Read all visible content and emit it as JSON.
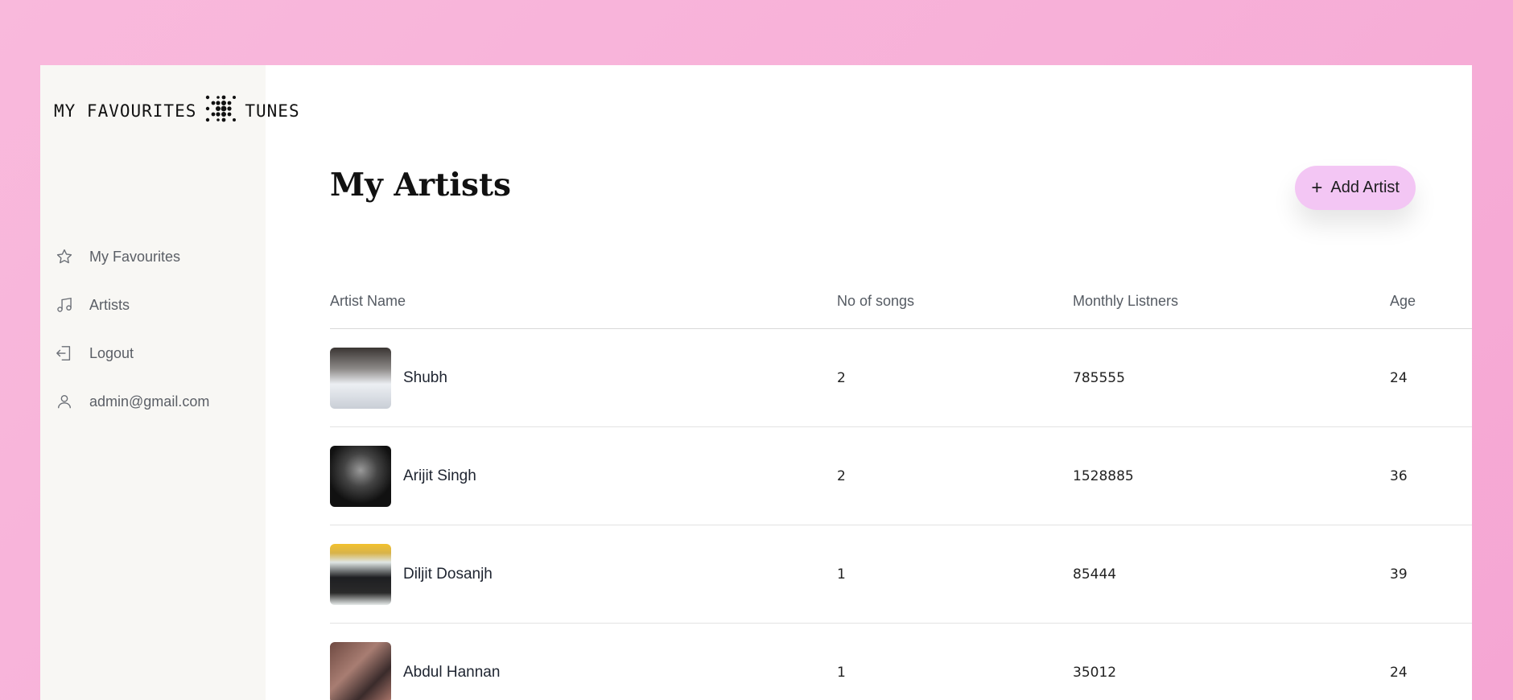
{
  "logo": {
    "left_text": "MY FAVOURITES",
    "right_text": "TUNES",
    "icon": "dotted-waveform-icon"
  },
  "nav": [
    {
      "label": "My Favourites",
      "icon": "star-icon"
    },
    {
      "label": "Artists",
      "icon": "music-note-icon"
    },
    {
      "label": "Logout",
      "icon": "logout-icon"
    },
    {
      "label": "admin@gmail.com",
      "icon": "user-icon"
    }
  ],
  "page": {
    "title": "My Artists"
  },
  "add_button": {
    "icon": "+",
    "label": "Add Artist"
  },
  "table": {
    "headers": [
      "Artist Name",
      "No of songs",
      "Monthly Listners",
      "Age"
    ],
    "rows": [
      {
        "name": "Shubh",
        "songs": "2",
        "listeners": "785555",
        "age": "24"
      },
      {
        "name": "Arijit Singh",
        "songs": "2",
        "listeners": "1528885",
        "age": "36"
      },
      {
        "name": "Diljit Dosanjh",
        "songs": "1",
        "listeners": "85444",
        "age": "39"
      },
      {
        "name": "Abdul Hannan",
        "songs": "1",
        "listeners": "35012",
        "age": "24"
      }
    ]
  },
  "colors": {
    "background_pink": "#f7b0d8",
    "sidebar_bg": "#f8f7f4",
    "button_bg": "#f3c6f4"
  }
}
